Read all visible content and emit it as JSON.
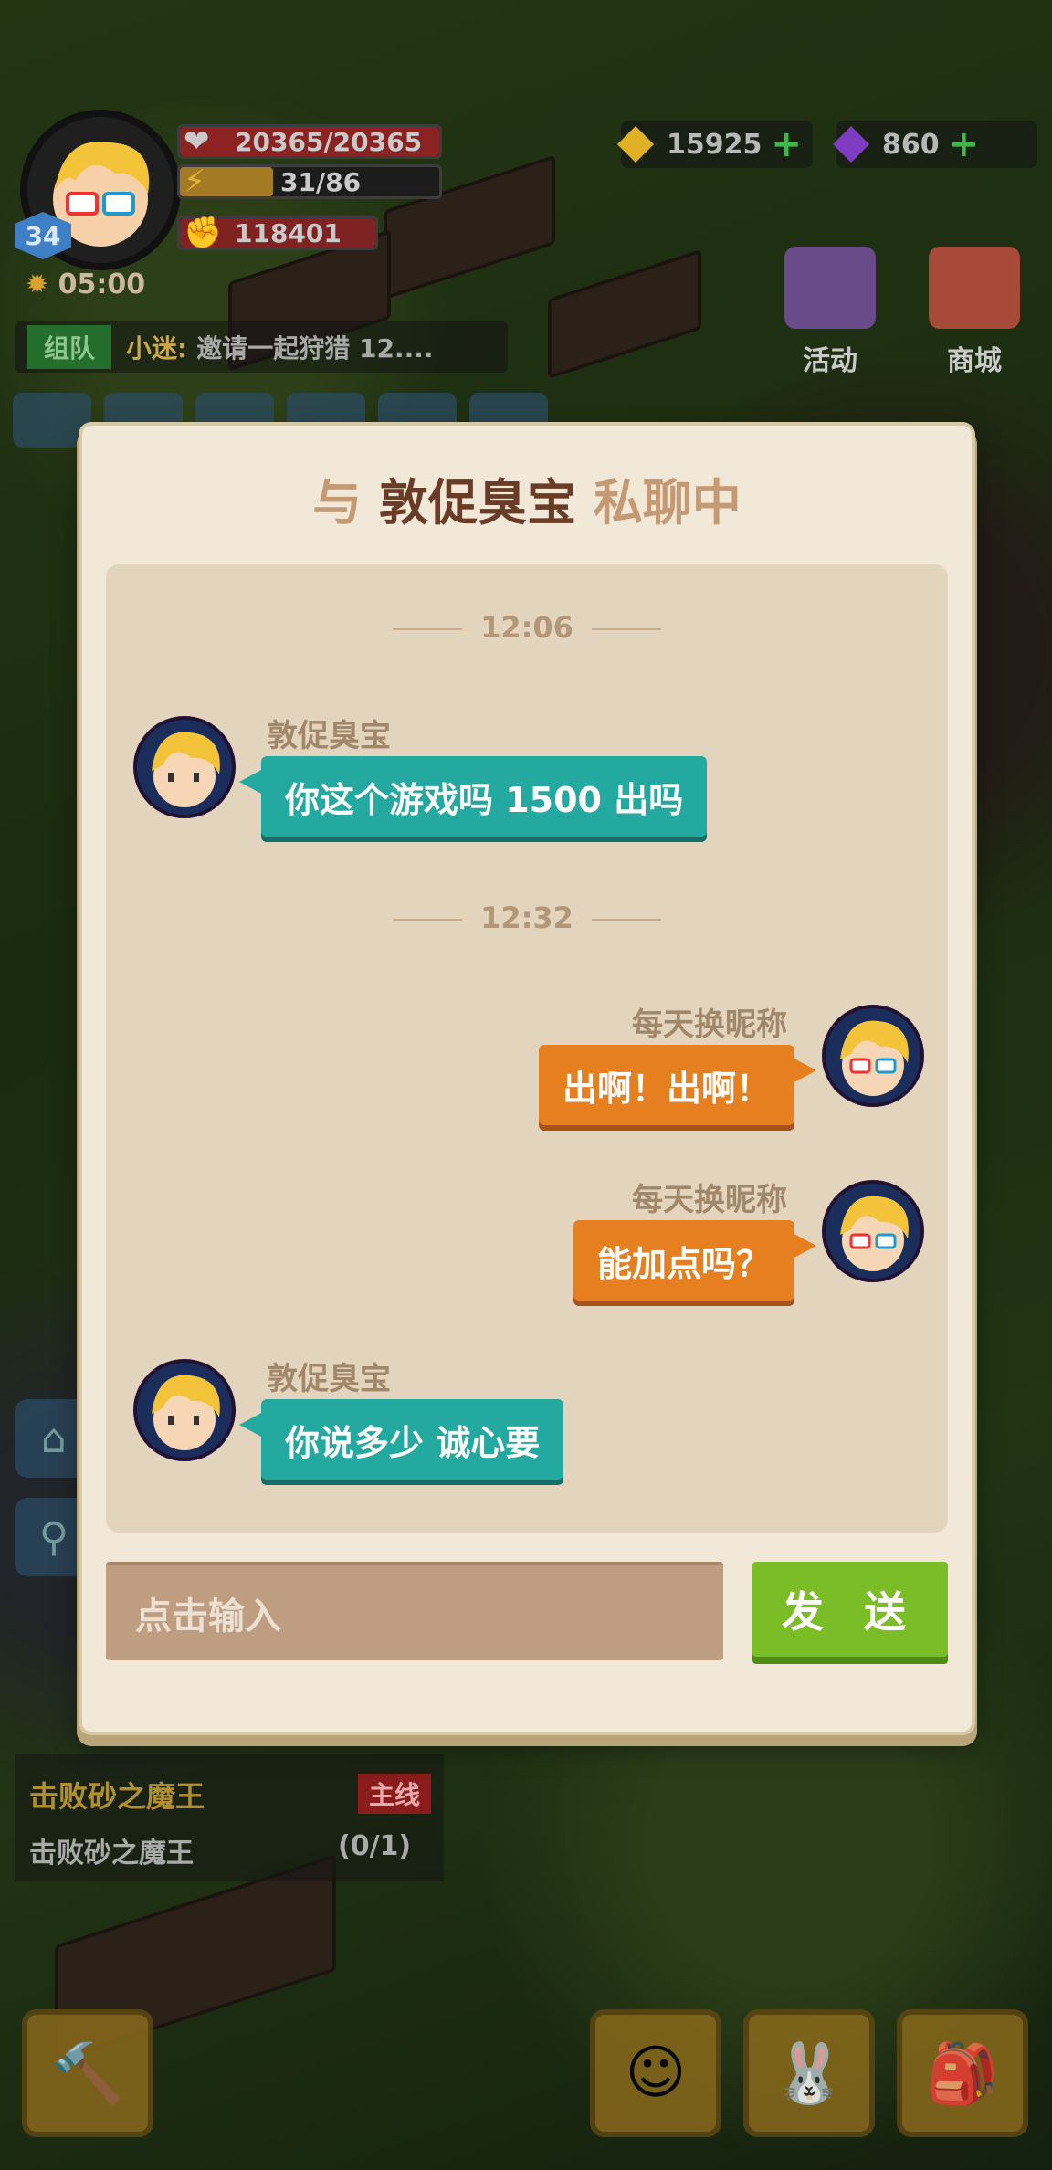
{
  "hud": {
    "level": "34",
    "health": "20365/20365",
    "energy": "31/86",
    "power": "118401",
    "timer": "05:00",
    "currency1": "15925",
    "currency2": "860",
    "team_tag": "组队",
    "team_name": "小迷:",
    "team_msg": "邀请一起狩猎 12....",
    "btn_event": "活动",
    "btn_shop": "商城",
    "quest_title": "击败砂之魔王",
    "quest_badge": "主线",
    "quest_sub": "击败砂之魔王",
    "quest_progress": "(0/1)"
  },
  "dialog": {
    "title_prefix": "与",
    "title_name": "敦促臭宝",
    "title_suffix": "私聊中",
    "input_placeholder": "点击输入",
    "send_label": "发 送"
  },
  "chat": {
    "time1": "12:06",
    "time2": "12:32",
    "msg1_name": "敦促臭宝",
    "msg1_text": "你这个游戏吗 1500 出吗",
    "msg2_name": "每天换昵称",
    "msg2_text": "出啊！出啊！",
    "msg3_name": "每天换昵称",
    "msg3_text": "能加点吗？",
    "msg4_name": "敦促臭宝",
    "msg4_text": "你说多少 诚心要"
  },
  "colors": {
    "teal_bubble": "#23a9a0",
    "orange_bubble": "#e67f1f",
    "send_button": "#7bbd27",
    "panel": "#f1e8d7"
  }
}
